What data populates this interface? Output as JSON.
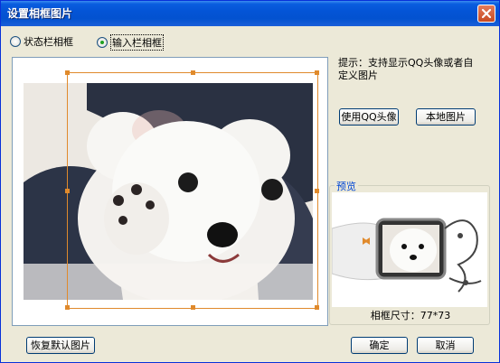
{
  "window": {
    "title": "设置相框图片"
  },
  "radios": [
    {
      "label": "状态栏相框",
      "checked": false
    },
    {
      "label": "输入栏相框",
      "checked": true
    }
  ],
  "hint": "提示：支持显示QQ头像或者自定义图片",
  "buttons": {
    "use_qq_avatar": "使用QQ头像",
    "local_image": "本地图片",
    "restore_default": "恢复默认图片",
    "ok": "确定",
    "cancel": "取消"
  },
  "preview": {
    "legend": "预览",
    "frame_size": "相框尺寸：77*73"
  }
}
